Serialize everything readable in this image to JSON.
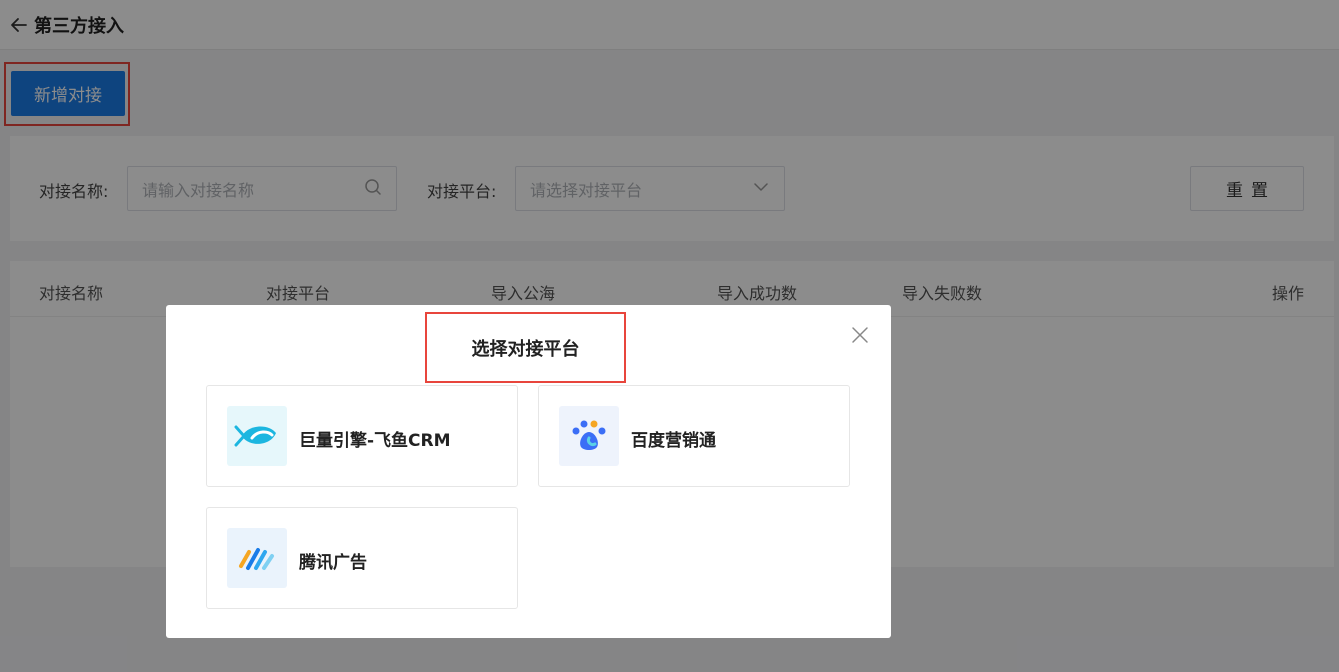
{
  "header": {
    "title": "第三方接入"
  },
  "toolbar": {
    "add_label": "新增对接"
  },
  "filter": {
    "name_label": "对接名称:",
    "name_placeholder": "请输入对接名称",
    "platform_label": "对接平台:",
    "platform_placeholder": "请选择对接平台",
    "reset_label": "重置"
  },
  "table": {
    "columns": [
      "对接名称",
      "对接平台",
      "导入公海",
      "导入成功数",
      "导入失败数",
      "操作"
    ]
  },
  "dialog": {
    "title": "选择对接平台",
    "platforms": [
      {
        "name": "巨量引擎-飞鱼CRM",
        "icon": "fish-icon"
      },
      {
        "name": "百度营销通",
        "icon": "paw-icon"
      },
      {
        "name": "腾讯广告",
        "icon": "stripes-icon"
      }
    ]
  },
  "colors": {
    "primary": "#1a7ce8",
    "highlight": "#e8453c"
  }
}
